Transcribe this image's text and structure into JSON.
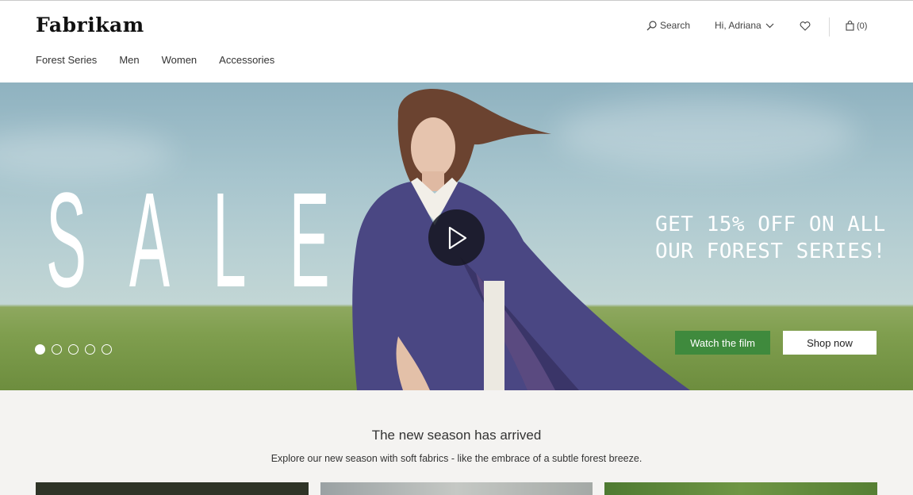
{
  "brand": {
    "logo": "Fabrikam"
  },
  "utility": {
    "search_label": "Search",
    "greeting": "Hi, Adriana",
    "cart_count": "(0)"
  },
  "nav": {
    "items": [
      {
        "label": "Forest Series"
      },
      {
        "label": "Men"
      },
      {
        "label": "Women"
      },
      {
        "label": "Accessories"
      }
    ]
  },
  "hero": {
    "headline_letters": [
      "S",
      "A",
      "L",
      "E"
    ],
    "promo_line1": "GET 15% OFF ON ALL",
    "promo_line2": "OUR FOREST SERIES!",
    "watch_button": "Watch the film",
    "shop_button": "Shop now",
    "carousel": {
      "slide_count": 5,
      "active_index": 0
    }
  },
  "section": {
    "title": "The new season has arrived",
    "subtitle": "Explore our new season with soft fabrics - like the embrace of a subtle forest breeze."
  },
  "colors": {
    "primary_button": "#3f8a3d",
    "header_bg": "#ffffff",
    "page_bg": "#f4f3f1"
  },
  "icons": [
    "search-icon",
    "chevron-down-icon",
    "heart-icon",
    "shopping-bag-icon",
    "play-icon"
  ]
}
